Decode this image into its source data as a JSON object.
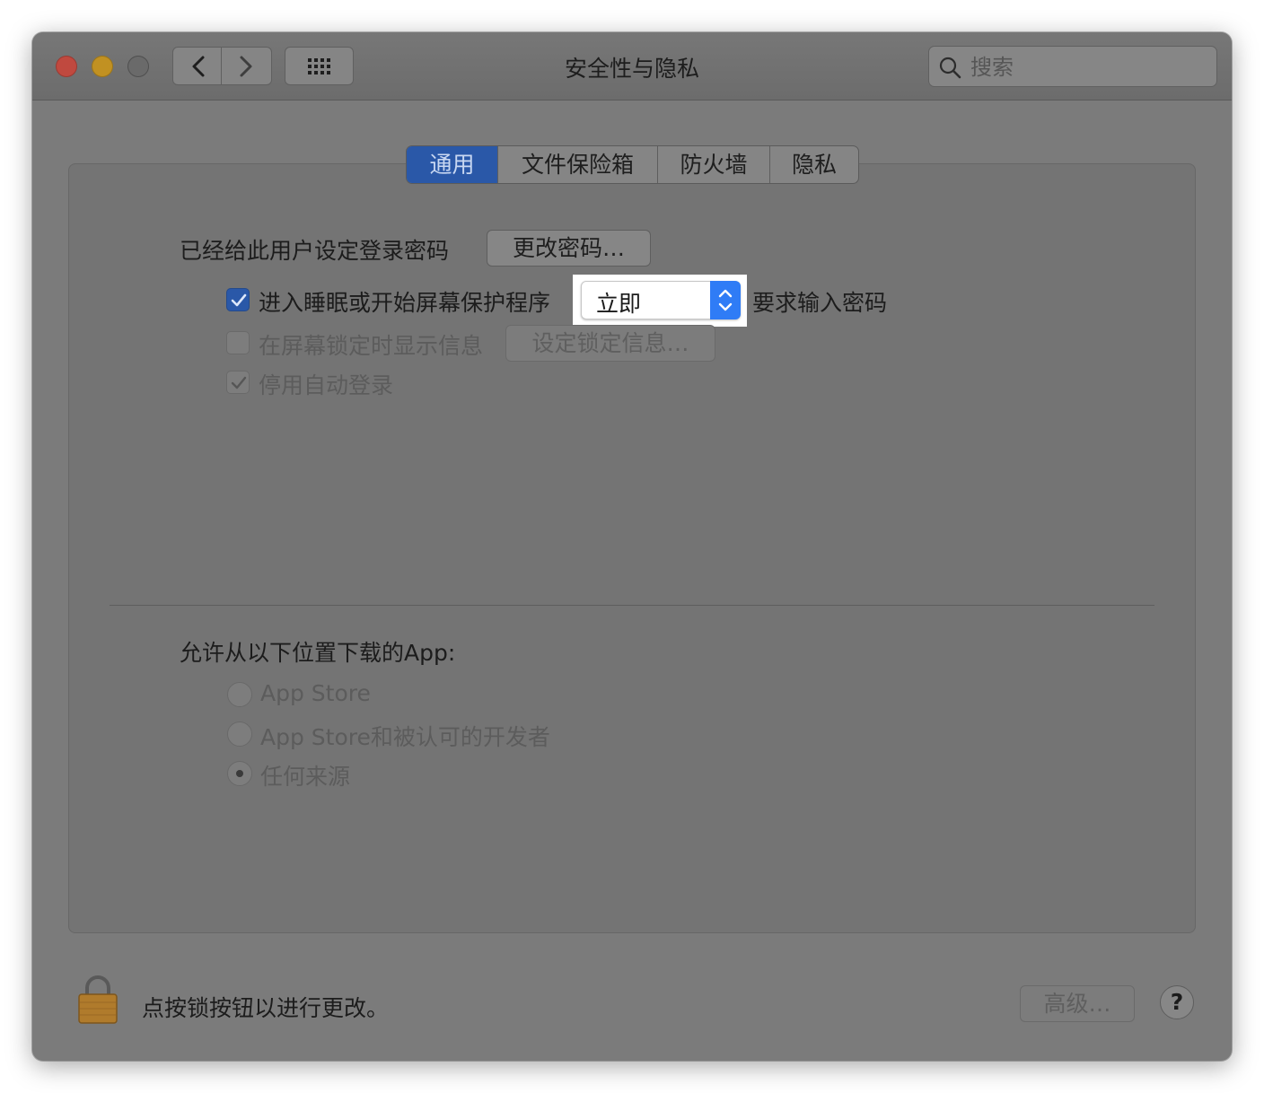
{
  "window": {
    "title": "安全性与隐私",
    "search_placeholder": "搜索"
  },
  "tabs": [
    {
      "label": "通用",
      "active": true
    },
    {
      "label": "文件保险箱",
      "active": false
    },
    {
      "label": "防火墙",
      "active": false
    },
    {
      "label": "隐私",
      "active": false
    }
  ],
  "general": {
    "password_set_label": "已经给此用户设定登录密码",
    "change_password_button": "更改密码…",
    "require_password": {
      "checked": true,
      "label": "进入睡眠或开始屏幕保护程序",
      "delay_value": "立即",
      "suffix": "要求输入密码"
    },
    "show_message": {
      "checked": false,
      "label": "在屏幕锁定时显示信息",
      "button": "设定锁定信息…"
    },
    "disable_auto_login": {
      "checked": true,
      "label": "停用自动登录"
    }
  },
  "downloads": {
    "heading": "允许从以下位置下载的App:",
    "options": [
      {
        "label": "App Store",
        "selected": false
      },
      {
        "label": "App Store和被认可的开发者",
        "selected": false
      },
      {
        "label": "任何来源",
        "selected": true
      }
    ]
  },
  "footer": {
    "lock_text": "点按锁按钮以进行更改。",
    "advanced_button": "高级…",
    "help_label": "?"
  },
  "colors": {
    "accent": "#2a58a8",
    "popup_arrow": "#2f7cf6",
    "close": "#c0493f",
    "minimize": "#c19122"
  }
}
